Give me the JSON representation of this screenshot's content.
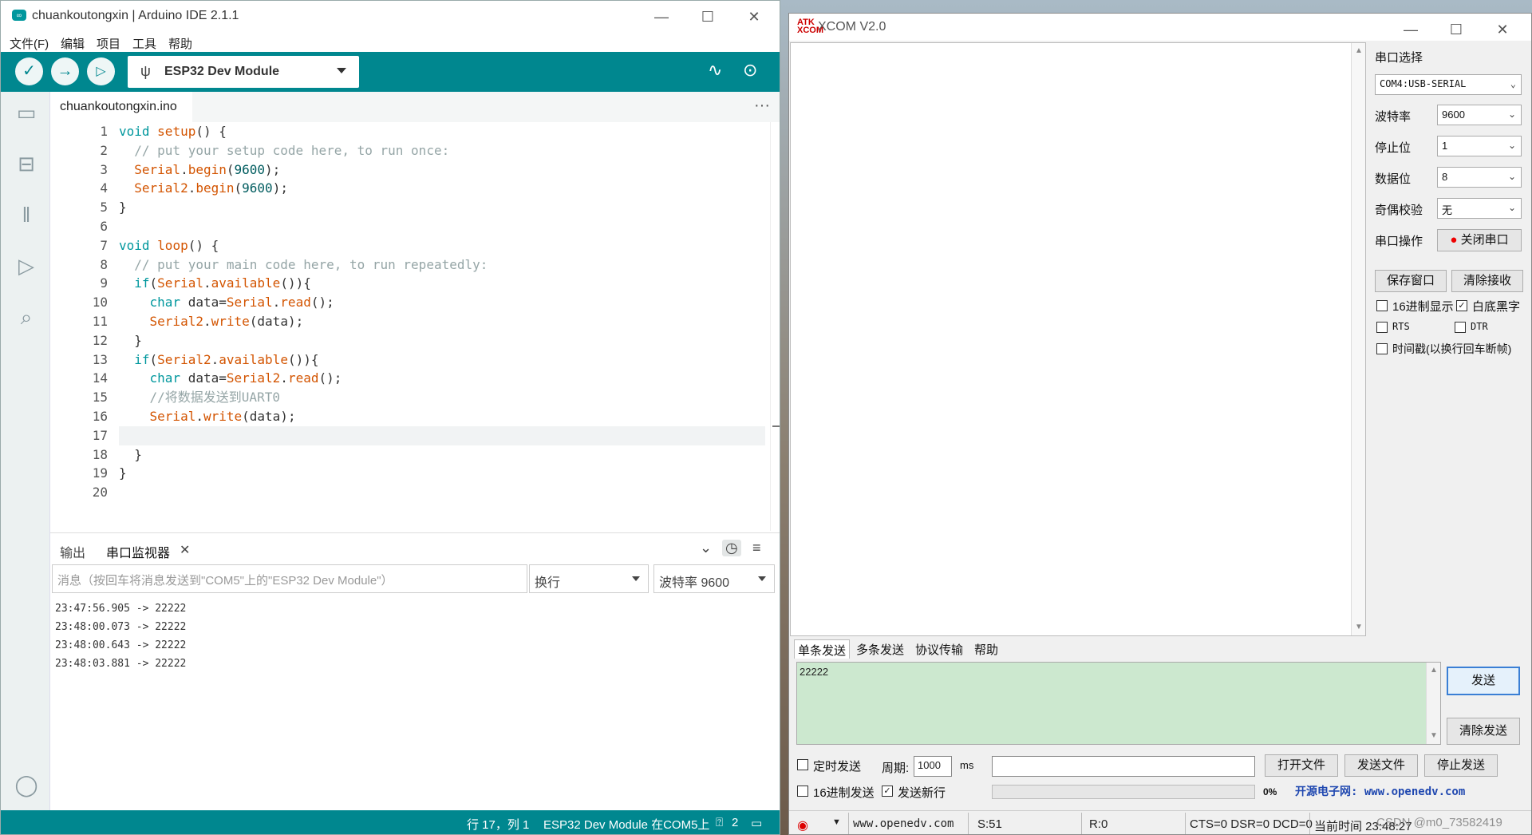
{
  "arduino": {
    "title": "chuankoutongxin | Arduino IDE 2.1.1",
    "logo_text": "∞",
    "window_controls": {
      "minimize": "—",
      "maximize": "☐",
      "close": "✕"
    },
    "menu": [
      "文件(F)",
      "编辑",
      "项目",
      "工具",
      "帮助"
    ],
    "toolbar": {
      "verify_icon": "check-icon",
      "upload_icon": "arrow-right-icon",
      "debug_icon": "debug-icon",
      "board": "ESP32 Dev Module",
      "plotter_icon": "serial-plotter-icon",
      "monitor_icon": "serial-monitor-icon"
    },
    "sidebar": [
      "folder-icon",
      "board-manager-icon",
      "library-icon",
      "debug-icon",
      "search-icon",
      "account-icon"
    ],
    "tab": "chuankoutongxin.ino",
    "tab_more": "···",
    "line_numbers": [
      "1",
      "2",
      "3",
      "4",
      "5",
      "6",
      "7",
      "8",
      "9",
      "10",
      "11",
      "12",
      "13",
      "14",
      "15",
      "16",
      "17",
      "18",
      "19",
      "20"
    ],
    "code_lines": [
      "void setup() {",
      "  // put your setup code here, to run once:",
      "  Serial.begin(9600);",
      "  Serial2.begin(9600);",
      "}",
      "",
      "void loop() {",
      "  // put your main code here, to run repeatedly:",
      "  if(Serial.available()){",
      "    char data=Serial.read();",
      "    Serial2.write(data);",
      "  }",
      "  if(Serial2.available()){",
      "    char data=Serial2.read();",
      "    //将数据发送到UART0",
      "    Serial.write(data);",
      "",
      "  }",
      "}",
      ""
    ],
    "panel": {
      "tab_output": "输出",
      "tab_monitor": "串口监视器",
      "tab_close": "✕",
      "input_placeholder": "消息（按回车将消息发送到\"COM5\"上的\"ESP32 Dev Module\"）",
      "line_ending": "换行",
      "baud": "波特率 9600",
      "monitor_lines": [
        "23:47:56.905 -> 22222",
        "23:48:00.073 -> 22222",
        "23:48:00.643 -> 22222",
        "23:48:03.881 -> 22222"
      ]
    },
    "status": {
      "position": "行 17，列 1",
      "board_port": "ESP32 Dev Module 在COM5上",
      "notifications": "2"
    }
  },
  "xcom": {
    "title": "XCOM V2.0",
    "logo_text": "ATK XCOM",
    "window_controls": {
      "minimize": "—",
      "maximize": "☐",
      "close": "✕"
    },
    "port_label": "串口选择",
    "port_value": "COM4:USB-SERIAL",
    "baud_label": "波特率",
    "baud_value": "9600",
    "stop_label": "停止位",
    "stop_value": "1",
    "data_label": "数据位",
    "data_value": "8",
    "parity_label": "奇偶校验",
    "parity_value": "无",
    "op_label": "串口操作",
    "close_port": "关闭串口",
    "save_window": "保存窗口",
    "clear_recv": "清除接收",
    "hex_display": "16进制显示",
    "white_black": "白底黑字",
    "rts": "RTS",
    "dtr": "DTR",
    "timestamp": "时间戳(以换行回车断帧)",
    "tabs": [
      "单条发送",
      "多条发送",
      "协议传输",
      "帮助"
    ],
    "send_text": "22222",
    "send_btn": "发送",
    "clear_send": "清除发送",
    "timed_send": "定时发送",
    "period_label": "周期:",
    "period_value": "1000",
    "ms": "ms",
    "open_file": "打开文件",
    "send_file": "发送文件",
    "stop_send": "停止发送",
    "hex_send": "16进制发送",
    "send_newline": "发送新行",
    "percent": "0%",
    "website_banner": "开源电子网: www.openedv.com",
    "status": {
      "url": "www.openedv.com",
      "sent": "S:51",
      "recv": "R:0",
      "lines": "CTS=0 DSR=0 DCD=0",
      "time": "当前时间 23:48:27"
    },
    "watermark": "CSDN @m0_73582419"
  }
}
